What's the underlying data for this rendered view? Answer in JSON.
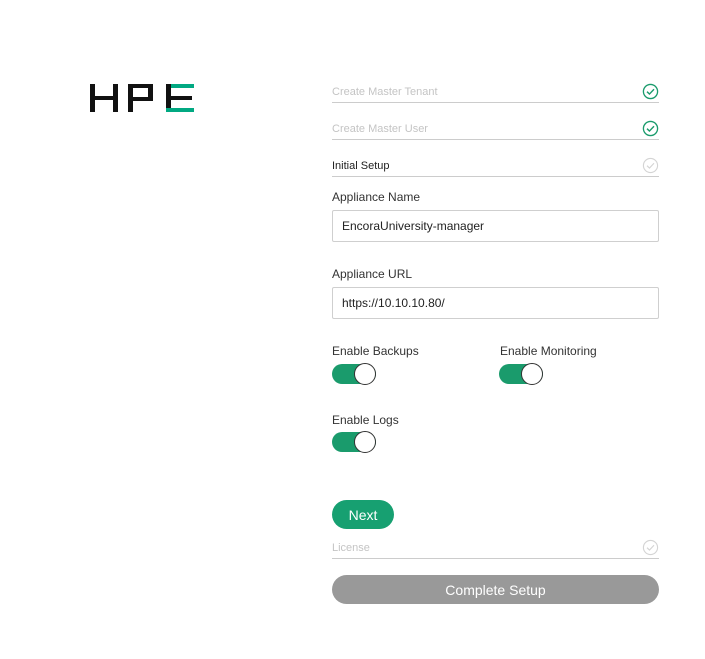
{
  "brand": {
    "logo_text": "HPE",
    "accent_color": "#01a982"
  },
  "steps": {
    "master_tenant": {
      "label": "Create Master Tenant",
      "status": "complete"
    },
    "master_user": {
      "label": "Create Master User",
      "status": "complete"
    },
    "initial_setup": {
      "label": "Initial Setup",
      "status": "active"
    },
    "license": {
      "label": "License",
      "status": "pending"
    }
  },
  "form": {
    "appliance_name": {
      "label": "Appliance Name",
      "value": "EncoraUniversity-manager"
    },
    "appliance_url": {
      "label": "Appliance URL",
      "value": "https://10.10.10.80/"
    },
    "enable_backups": {
      "label": "Enable Backups",
      "on": true
    },
    "enable_monitoring": {
      "label": "Enable Monitoring",
      "on": true
    },
    "enable_logs": {
      "label": "Enable Logs",
      "on": true
    }
  },
  "buttons": {
    "next": "Next",
    "complete_setup": "Complete Setup"
  },
  "colors": {
    "toggle_on": "#1a9b6c",
    "check_done": "#1a9b6c",
    "check_pending": "#cccccc",
    "disabled_button": "#999999"
  }
}
